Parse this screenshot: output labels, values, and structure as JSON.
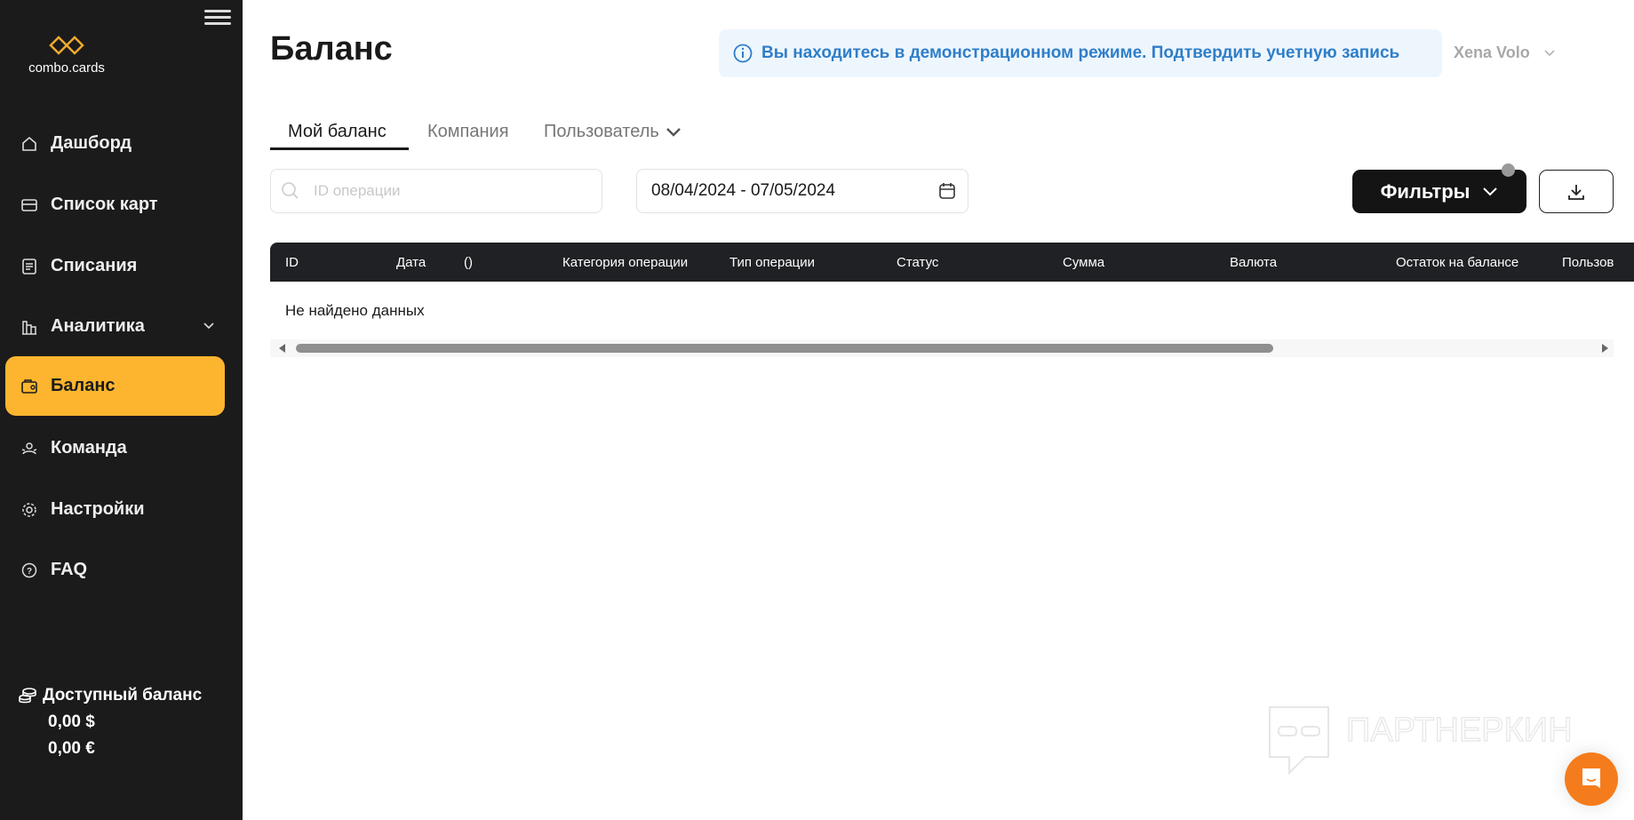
{
  "sidebar": {
    "logo_text": "combo.cards",
    "items": [
      {
        "label": "Дашборд",
        "icon": "home-icon"
      },
      {
        "label": "Список карт",
        "icon": "card-icon"
      },
      {
        "label": "Списания",
        "icon": "document-icon"
      },
      {
        "label": "Аналитика",
        "icon": "chart-icon"
      },
      {
        "label": "Баланс",
        "icon": "wallet-icon",
        "active": true
      },
      {
        "label": "Команда",
        "icon": "team-icon"
      },
      {
        "label": "Настройки",
        "icon": "gear-icon"
      },
      {
        "label": "FAQ",
        "icon": "question-icon"
      }
    ],
    "balance": {
      "label": "Доступный баланс",
      "usd": "0,00 $",
      "eur": "0,00 €"
    }
  },
  "header": {
    "title": "Баланс",
    "banner_text": "Вы находитесь в демонстрационном режиме.",
    "banner_link": "Подтвердить учетную запись",
    "user": "Xena Volo"
  },
  "tabs": [
    "Мой баланс",
    "Компания",
    "Пользователь"
  ],
  "search": {
    "placeholder": "ID операции"
  },
  "date_range": "08/04/2024 - 07/05/2024",
  "filters_label": "Фильтры",
  "table": {
    "columns": [
      "ID",
      "Дата",
      "()",
      "Категория операции",
      "Тип операции",
      "Статус",
      "Сумма",
      "Валюта",
      "Остаток на балансе",
      "Пользов"
    ],
    "empty": "Не найдено данных"
  },
  "watermark": "ПАРТНЕРКИН",
  "colors": {
    "accent": "#fdb52f",
    "banner_text": "#2f7ec9",
    "chat": "#f57c1c"
  }
}
